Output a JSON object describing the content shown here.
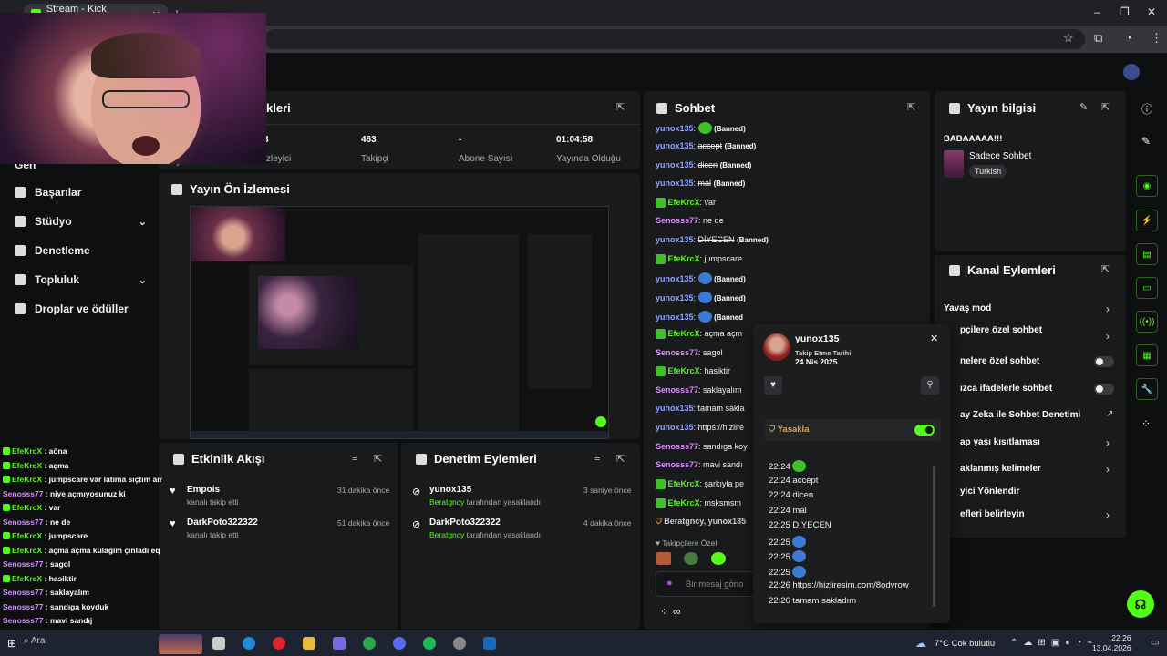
{
  "browser": {
    "tab_title": "Stream - Kick Dashboard",
    "new_tab": "+",
    "tab_close": "✕"
  },
  "sidebar": {
    "items": [
      {
        "label": "Başarılar"
      },
      {
        "label": "Stüdyo"
      },
      {
        "label": "Denetleme"
      },
      {
        "label": "Topluluk"
      },
      {
        "label": "Droplar ve ödüller"
      }
    ],
    "partial_top": "Gen"
  },
  "stats": {
    "title": "kleri",
    "items": [
      {
        "value": "3",
        "label": "zleyici"
      },
      {
        "value": "463",
        "label": "Takipçi"
      },
      {
        "value": "-",
        "label": "Abone Sayısı"
      },
      {
        "value": "01:04:58",
        "label": "Yayında Olduğu Süre"
      }
    ],
    "partial_left": "Yayın"
  },
  "preview": {
    "title": "Yayın Ön İzlemesi"
  },
  "activity": {
    "title": "Etkinlik Akışı",
    "events": [
      {
        "name": "Empois",
        "sub": "kanalı takip etti",
        "time": "31 dakika önce"
      },
      {
        "name": "DarkPoto322322",
        "sub": "kanalı takip etti",
        "time": "51 dakika önce"
      }
    ]
  },
  "moderation": {
    "title": "Denetim Eylemleri",
    "events": [
      {
        "name": "yunox135",
        "by": "Beratgncy",
        "sub": "tarafından yasaklandı",
        "time": "3 saniye önce"
      },
      {
        "name": "DarkPoto322322",
        "by": "Beratgncy",
        "sub": "tarafından yasaklandı",
        "time": "4 dakika önce"
      }
    ]
  },
  "chat": {
    "title": "Sohbet",
    "lines": [
      {
        "user": "yunox135",
        "text": "",
        "banned": "(Banned)"
      },
      {
        "user": "yunox135",
        "text": "accept",
        "banned": "(Banned)"
      },
      {
        "user": "yunox135",
        "text": "dicen",
        "banned": "(Banned)"
      },
      {
        "user": "yunox135",
        "text": "mal",
        "banned": "(Banned)"
      },
      {
        "user": "EfeKrcX",
        "text": "var"
      },
      {
        "user": "Senosss77",
        "text": "ne de"
      },
      {
        "user": "yunox135",
        "text": "DİYECEN",
        "banned": "(Banned)"
      },
      {
        "user": "EfeKrcX",
        "text": "jumpscare"
      },
      {
        "user": "yunox135",
        "text": "",
        "banned": "(Banned)"
      },
      {
        "user": "yunox135",
        "text": "",
        "banned": "(Banned)"
      },
      {
        "user": "yunox135",
        "text": "",
        "banned": "(Banned"
      },
      {
        "user": "EfeKrcX",
        "text": "açma açm"
      },
      {
        "user": "Senosss77",
        "text": "sagol"
      },
      {
        "user": "EfeKrcX",
        "text": "hasiktir"
      },
      {
        "user": "Senosss77",
        "text": "saklayalım"
      },
      {
        "user": "yunox135",
        "text": "tamam sakla"
      },
      {
        "user": "yunox135",
        "text": "https://hizlire"
      },
      {
        "user": "Senosss77",
        "text": "sandıga koy"
      },
      {
        "user": "Senosss77",
        "text": "mavi sandı"
      },
      {
        "user": "EfeKrcX",
        "text": "şarkıyla pe"
      },
      {
        "user": "EfeKrcX",
        "text": "msksmsm"
      }
    ],
    "ban_notice": "Beratgncy, yunox135",
    "followers_only": "Takipçilere Özel",
    "placeholder": "Bir mesaj göno",
    "bottom": "∞"
  },
  "stream_info": {
    "title": "Yayın bilgisi",
    "stream_title": "BABAAAAA!!!",
    "category": "Sadece Sohbet",
    "tag": "Turkish"
  },
  "channel_actions": {
    "title": "Kanal Eylemleri",
    "items": [
      {
        "label": "Yavaş mod"
      },
      {
        "label": "pçilere özel sohbet"
      },
      {
        "label": "nelere özel sohbet"
      },
      {
        "label": "ızca ifadelerle sohbet"
      },
      {
        "label": "ay Zeka ile Sohbet Denetimi"
      },
      {
        "label": "ap yaşı kısıtlaması"
      },
      {
        "label": "aklanmış kelimeler"
      },
      {
        "label": "yici Yönlendir"
      },
      {
        "label": "efleri belirleyin"
      }
    ]
  },
  "user_card": {
    "username": "yunox135",
    "follow_label": "Takip Etme Tarihi",
    "follow_date": "24 Nis 2025",
    "ban_label": "Yasakla",
    "ban_on": true,
    "history": [
      {
        "time": "22:24",
        "text": ""
      },
      {
        "time": "22:24",
        "text": "accept"
      },
      {
        "time": "22:24",
        "text": "dicen"
      },
      {
        "time": "22:24",
        "text": "mal"
      },
      {
        "time": "22:25",
        "text": "DİYECEN"
      },
      {
        "time": "22:25",
        "text": ""
      },
      {
        "time": "22:25",
        "text": ""
      },
      {
        "time": "22:25",
        "text": ""
      },
      {
        "time": "22:26",
        "text": "https://hizliresim.com/8odvrow"
      },
      {
        "time": "22:26",
        "text": "tamam sakladım"
      }
    ]
  },
  "overlay_chat": [
    {
      "user": "EfeKrcX",
      "text": "aöna"
    },
    {
      "user": "EfeKrcX",
      "text": "açma"
    },
    {
      "user": "EfeKrcX",
      "text": "jumpscare var latıma sıçtım amk"
    },
    {
      "user": "Senosss77",
      "text": "niye açmıyosunuz ki"
    },
    {
      "user": "EfeKrcX",
      "text": "var"
    },
    {
      "user": "Senosss77",
      "text": "ne de"
    },
    {
      "user": "EfeKrcX",
      "text": "jumpscare"
    },
    {
      "user": "EfeKrcX",
      "text": "açma açma kulağım çınladı eq"
    },
    {
      "user": "Senosss77",
      "text": "sagol"
    },
    {
      "user": "EfeKrcX",
      "text": "hasiktir"
    },
    {
      "user": "Senosss77",
      "text": "saklayalım"
    },
    {
      "user": "Senosss77",
      "text": "sandıga koyduk"
    },
    {
      "user": "Senosss77",
      "text": "mavi sandıj"
    },
    {
      "user": "EfeKrcX",
      "text": "şarkıyla peki"
    },
    {
      "user": "EfeKrcX",
      "text": "msksmsmsk"
    }
  ],
  "taskbar": {
    "search": "Ara",
    "weather": "7°C  Çok bulutlu",
    "time": "22:26",
    "date": "13.04.2026"
  },
  "colors": {
    "accent": "#53fc18",
    "panel": "#191a1c",
    "bg": "#0e0f10"
  }
}
